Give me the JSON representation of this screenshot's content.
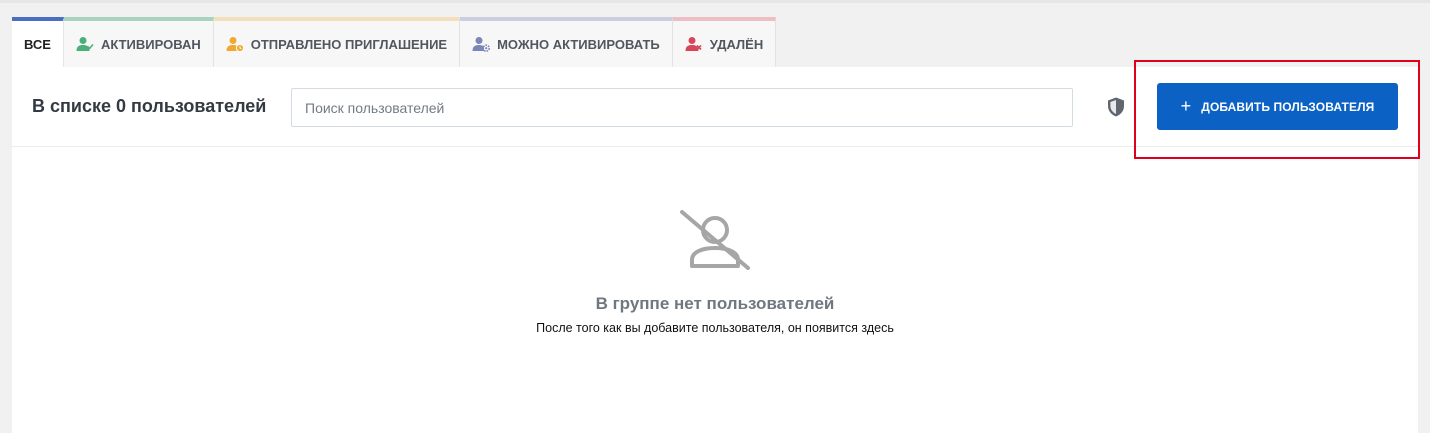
{
  "tabs": [
    {
      "label": "ВСЕ",
      "icon": "none",
      "accent": "#4a6fc2"
    },
    {
      "label": "АКТИВИРОВАН",
      "icon": "user-check-icon",
      "accent": "#a8d3be"
    },
    {
      "label": "ОТПРАВЛЕНО ПРИГЛАШЕНИЕ",
      "icon": "user-clock-icon",
      "accent": "#f4dfbd"
    },
    {
      "label": "МОЖНО АКТИВИРОВАТЬ",
      "icon": "user-gear-icon",
      "accent": "#c9cfe1"
    },
    {
      "label": "УДАЛЁН",
      "icon": "user-x-icon",
      "accent": "#edbfc5"
    }
  ],
  "toolbar": {
    "count_title": "В списке 0 пользователей",
    "search_placeholder": "Поиск пользователей",
    "shield_icon": "shield-icon",
    "add_button_label": "ДОБАВИТЬ ПОЛЬЗОВАТЕЛЯ",
    "add_button_icon": "+"
  },
  "empty_state": {
    "icon": "user-slash-icon",
    "title": "В группе нет пользователей",
    "subtitle": "После того как вы добавите пользователя, он появится здесь"
  },
  "colors": {
    "primary": "#0b62c4",
    "highlight": "#e0001b",
    "activated": "#4caf7a",
    "invited": "#f0a830",
    "can_activate": "#7a86b8",
    "deleted": "#d9465a"
  }
}
